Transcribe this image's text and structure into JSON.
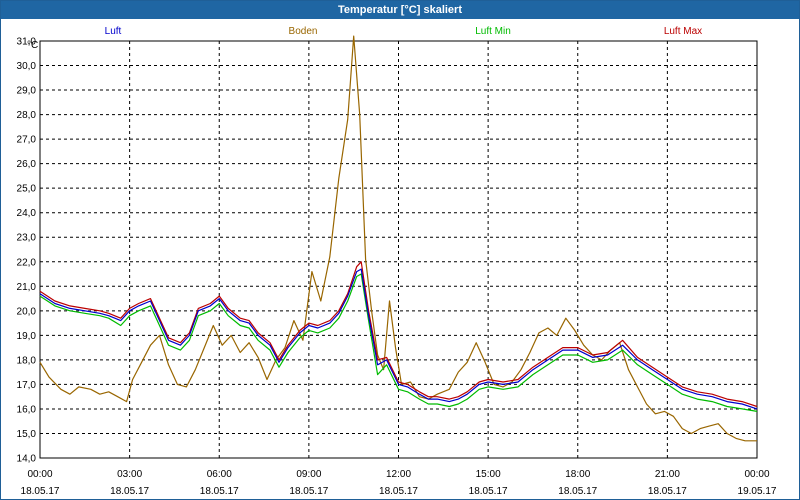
{
  "window": {
    "title": "Temperatur [°C] skaliert"
  },
  "chart_data": {
    "type": "line",
    "unit": "°C",
    "ylim": [
      14.0,
      31.0
    ],
    "yticks": [
      "14,0",
      "15,0",
      "16,0",
      "17,0",
      "18,0",
      "19,0",
      "20,0",
      "21,0",
      "22,0",
      "23,0",
      "24,0",
      "25,0",
      "26,0",
      "27,0",
      "28,0",
      "29,0",
      "30,0",
      "31,0"
    ],
    "xlim_hours": [
      0,
      24
    ],
    "xticks": [
      {
        "time": "00:00",
        "date": "18.05.17"
      },
      {
        "time": "03:00",
        "date": "18.05.17"
      },
      {
        "time": "06:00",
        "date": "18.05.17"
      },
      {
        "time": "09:00",
        "date": "18.05.17"
      },
      {
        "time": "12:00",
        "date": "18.05.17"
      },
      {
        "time": "15:00",
        "date": "18.05.17"
      },
      {
        "time": "18:00",
        "date": "18.05.17"
      },
      {
        "time": "21:00",
        "date": "18.05.17"
      },
      {
        "time": "00:00",
        "date": "19.05.17"
      }
    ],
    "grid": true,
    "legend_position": "top",
    "series": [
      {
        "name": "Luft",
        "color": "#0000cc",
        "x": [
          0,
          0.5,
          1,
          1.5,
          2,
          2.3,
          2.7,
          3,
          3.3,
          3.7,
          4,
          4.3,
          4.7,
          5,
          5.3,
          5.7,
          6,
          6.3,
          6.7,
          7,
          7.3,
          7.7,
          8,
          8.3,
          8.7,
          9,
          9.3,
          9.7,
          10,
          10.3,
          10.6,
          10.75,
          11,
          11.3,
          11.6,
          12,
          12.3,
          12.7,
          13,
          13.3,
          13.7,
          14,
          14.3,
          14.7,
          15,
          15.5,
          16,
          16.5,
          17,
          17.5,
          18,
          18.5,
          19,
          19.5,
          20,
          20.5,
          21,
          21.5,
          22,
          22.5,
          23,
          23.5,
          24
        ],
        "y": [
          20.7,
          20.3,
          20.1,
          20.0,
          19.9,
          19.8,
          19.6,
          20.0,
          20.2,
          20.4,
          19.6,
          18.8,
          18.6,
          19.0,
          20.0,
          20.2,
          20.5,
          20.0,
          19.6,
          19.5,
          19.0,
          18.6,
          17.9,
          18.5,
          19.1,
          19.4,
          19.3,
          19.5,
          19.9,
          20.6,
          21.6,
          21.7,
          19.8,
          17.8,
          18.0,
          17.0,
          16.9,
          16.6,
          16.4,
          16.4,
          16.3,
          16.4,
          16.6,
          17.0,
          17.1,
          17.0,
          17.1,
          17.6,
          18.0,
          18.4,
          18.4,
          18.1,
          18.2,
          18.6,
          18.0,
          17.6,
          17.2,
          16.8,
          16.6,
          16.5,
          16.3,
          16.2,
          16.0
        ]
      },
      {
        "name": "Boden",
        "color": "#996600",
        "x": [
          0,
          0.3,
          0.7,
          1,
          1.3,
          1.7,
          2,
          2.3,
          2.6,
          2.9,
          3.1,
          3.4,
          3.7,
          4,
          4.3,
          4.6,
          4.9,
          5.2,
          5.5,
          5.8,
          6.1,
          6.4,
          6.7,
          7,
          7.3,
          7.6,
          7.9,
          8.2,
          8.5,
          8.8,
          9.1,
          9.4,
          9.7,
          10,
          10.3,
          10.5,
          10.7,
          10.9,
          11.1,
          11.3,
          11.5,
          11.7,
          11.9,
          12.1,
          12.4,
          12.7,
          13,
          13.3,
          13.7,
          14,
          14.3,
          14.6,
          14.9,
          15.2,
          15.5,
          15.8,
          16.1,
          16.4,
          16.7,
          17,
          17.3,
          17.6,
          17.9,
          18.2,
          18.5,
          18.8,
          19.1,
          19.4,
          19.7,
          20,
          20.3,
          20.6,
          20.9,
          21.2,
          21.5,
          21.8,
          22.1,
          22.4,
          22.7,
          23,
          23.3,
          23.6,
          24
        ],
        "y": [
          17.9,
          17.3,
          16.8,
          16.6,
          16.9,
          16.8,
          16.6,
          16.7,
          16.5,
          16.3,
          17.2,
          17.9,
          18.6,
          19.0,
          17.8,
          17.0,
          16.9,
          17.6,
          18.5,
          19.4,
          18.6,
          19.0,
          18.3,
          18.7,
          18.1,
          17.2,
          18.0,
          18.5,
          19.6,
          18.8,
          21.6,
          20.4,
          22.2,
          25.4,
          27.8,
          31.2,
          28.0,
          22.1,
          20.0,
          18.2,
          17.6,
          20.4,
          18.5,
          17.0,
          17.1,
          16.5,
          16.4,
          16.6,
          16.8,
          17.5,
          17.9,
          18.7,
          17.9,
          17.0,
          16.9,
          17.1,
          17.6,
          18.3,
          19.1,
          19.3,
          19.0,
          19.7,
          19.2,
          18.6,
          18.2,
          18.0,
          18.4,
          18.7,
          17.6,
          16.9,
          16.2,
          15.8,
          15.9,
          15.7,
          15.2,
          15.0,
          15.2,
          15.3,
          15.4,
          15.0,
          14.8,
          14.7,
          14.7
        ]
      },
      {
        "name": "Luft Min",
        "color": "#00bb00",
        "x": [
          0,
          0.5,
          1,
          1.5,
          2,
          2.3,
          2.7,
          3,
          3.3,
          3.7,
          4,
          4.3,
          4.7,
          5,
          5.3,
          5.7,
          6,
          6.3,
          6.7,
          7,
          7.3,
          7.7,
          8,
          8.3,
          8.7,
          9,
          9.3,
          9.7,
          10,
          10.3,
          10.6,
          10.75,
          11,
          11.3,
          11.6,
          12,
          12.3,
          12.7,
          13,
          13.3,
          13.7,
          14,
          14.3,
          14.7,
          15,
          15.5,
          16,
          16.5,
          17,
          17.5,
          18,
          18.5,
          19,
          19.5,
          20,
          20.5,
          21,
          21.5,
          22,
          22.5,
          23,
          23.5,
          24
        ],
        "y": [
          20.6,
          20.2,
          20.0,
          19.9,
          19.8,
          19.7,
          19.4,
          19.8,
          20.0,
          20.2,
          19.4,
          18.6,
          18.4,
          18.8,
          19.8,
          20.0,
          20.3,
          19.8,
          19.4,
          19.3,
          18.8,
          18.4,
          17.7,
          18.3,
          18.9,
          19.2,
          19.1,
          19.3,
          19.7,
          20.4,
          21.4,
          21.5,
          19.6,
          17.4,
          17.8,
          16.8,
          16.7,
          16.4,
          16.2,
          16.2,
          16.1,
          16.2,
          16.4,
          16.8,
          16.9,
          16.8,
          16.9,
          17.4,
          17.8,
          18.2,
          18.2,
          17.9,
          18.0,
          18.4,
          17.8,
          17.4,
          17.0,
          16.6,
          16.4,
          16.3,
          16.1,
          16.0,
          15.9
        ]
      },
      {
        "name": "Luft Max",
        "color": "#bb0000",
        "x": [
          0,
          0.5,
          1,
          1.5,
          2,
          2.3,
          2.7,
          3,
          3.3,
          3.7,
          4,
          4.3,
          4.7,
          5,
          5.3,
          5.7,
          6,
          6.3,
          6.7,
          7,
          7.3,
          7.7,
          8,
          8.3,
          8.7,
          9,
          9.3,
          9.7,
          10,
          10.3,
          10.6,
          10.75,
          11,
          11.3,
          11.6,
          12,
          12.3,
          12.7,
          13,
          13.3,
          13.7,
          14,
          14.3,
          14.7,
          15,
          15.5,
          16,
          16.5,
          17,
          17.5,
          18,
          18.5,
          19,
          19.5,
          20,
          20.5,
          21,
          21.5,
          22,
          22.5,
          23,
          23.5,
          24
        ],
        "y": [
          20.8,
          20.4,
          20.2,
          20.1,
          20.0,
          19.9,
          19.7,
          20.1,
          20.3,
          20.5,
          19.7,
          18.9,
          18.7,
          19.1,
          20.1,
          20.3,
          20.6,
          20.1,
          19.7,
          19.6,
          19.1,
          18.7,
          18.0,
          18.6,
          19.2,
          19.5,
          19.4,
          19.6,
          20.0,
          20.7,
          21.8,
          22.0,
          20.0,
          18.0,
          18.1,
          17.1,
          17.0,
          16.7,
          16.5,
          16.5,
          16.4,
          16.5,
          16.7,
          17.1,
          17.2,
          17.1,
          17.2,
          17.7,
          18.1,
          18.5,
          18.5,
          18.2,
          18.3,
          18.8,
          18.1,
          17.7,
          17.3,
          16.9,
          16.7,
          16.6,
          16.4,
          16.3,
          16.1
        ]
      }
    ]
  }
}
